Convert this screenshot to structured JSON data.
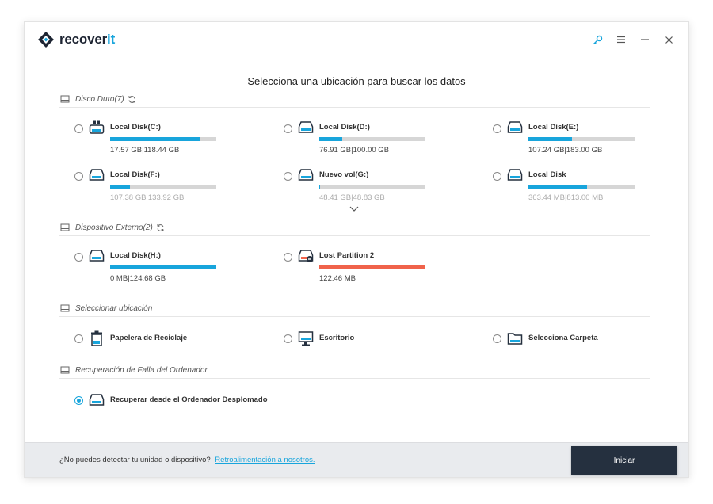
{
  "app": {
    "logo_text_main": "recover",
    "logo_text_accent": "it"
  },
  "window_controls": [
    "key-icon",
    "menu-icon",
    "minimize-icon",
    "close-icon"
  ],
  "page_title": "Selecciona una ubicación para buscar los datos",
  "sections": {
    "hard_disk": {
      "label": "Disco Duro(7)"
    },
    "external": {
      "label": "Dispositivo Externo(2)"
    },
    "location": {
      "label": "Seleccionar ubicación"
    },
    "crash": {
      "label": "Recuperación de Falla del Ordenador"
    }
  },
  "hard_disks": [
    {
      "name": "Local Disk(C:)",
      "size": "17.57  GB|118.44  GB",
      "usage": 0.85,
      "icon": "windows-drive-icon"
    },
    {
      "name": "Local Disk(D:)",
      "size": "76.91  GB|100.00  GB",
      "usage": 0.22,
      "icon": "drive-icon"
    },
    {
      "name": "Local Disk(E:)",
      "size": "107.24  GB|183.00  GB",
      "usage": 0.41,
      "icon": "drive-icon"
    },
    {
      "name": "Local Disk(F:)",
      "size": "107.38  GB|133.92  GB",
      "usage": 0.19,
      "icon": "drive-icon"
    },
    {
      "name": "Nuevo vol(G:)",
      "size": "48.41  GB|48.83  GB",
      "usage": 0.01,
      "icon": "drive-icon"
    },
    {
      "name": "Local Disk",
      "size": "363.44  MB|813.00  MB",
      "usage": 0.55,
      "icon": "drive-icon"
    }
  ],
  "external_devices": [
    {
      "name": "Local Disk(H:)",
      "size": "0 MB|124.68  GB",
      "usage": 1.0,
      "color": "#18a5dc"
    },
    {
      "name": "Lost Partition 2",
      "size": "122.46  MB",
      "usage": 1.0,
      "color": "#f0634b"
    }
  ],
  "locations": [
    {
      "name": "Papelera de Reciclaje",
      "icon": "recycle-bin-icon"
    },
    {
      "name": "Escritorio",
      "icon": "desktop-icon"
    },
    {
      "name": "Selecciona Carpeta",
      "icon": "folder-icon"
    }
  ],
  "crash_recovery": {
    "name": "Recuperar desde el Ordenador Desplomado",
    "selected": true
  },
  "footer": {
    "question": "¿No puedes detectar tu unidad o dispositivo?",
    "link": "Retroalimentación a nosotros.",
    "start_button": "Iniciar"
  },
  "colors": {
    "accent": "#18a5dc",
    "danger": "#f0634b",
    "button_dark": "#25303f"
  }
}
